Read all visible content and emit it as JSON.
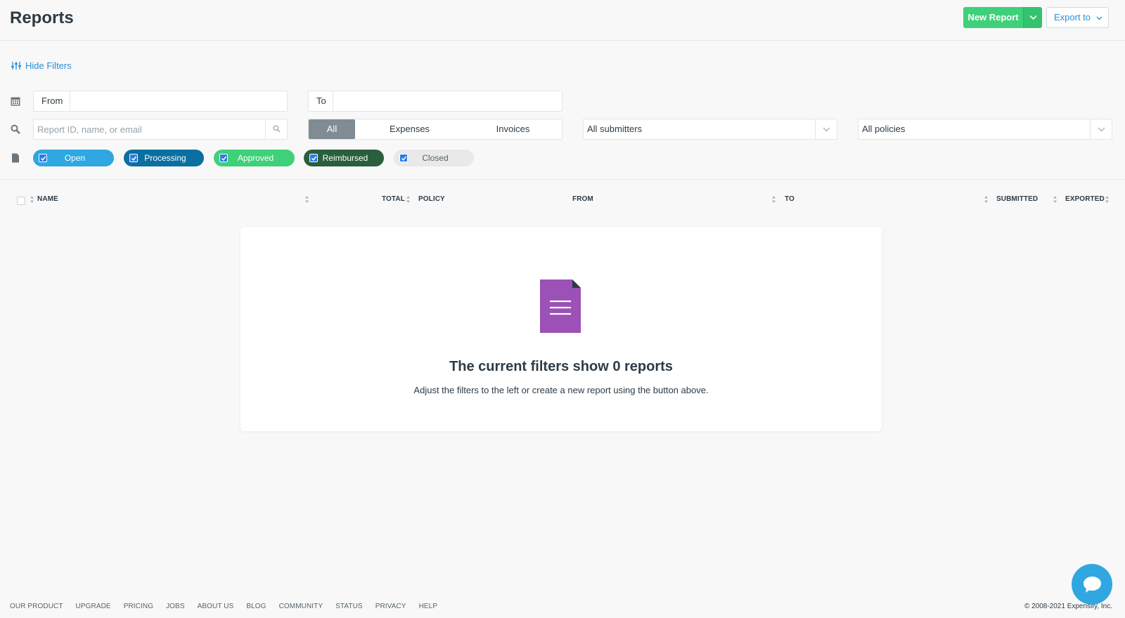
{
  "header": {
    "title": "Reports",
    "new_report_label": "New Report",
    "export_label": "Export to"
  },
  "filters": {
    "hide_filters_label": "Hide Filters",
    "from_label": "From",
    "from_value": "",
    "to_label": "To",
    "to_value": "",
    "search_placeholder": "Report ID, name, or email",
    "type_tabs": [
      {
        "label": "All",
        "active": true
      },
      {
        "label": "Expenses",
        "active": false
      },
      {
        "label": "Invoices",
        "active": false
      }
    ],
    "submitters_value": "All submitters",
    "policies_value": "All policies",
    "statuses": [
      {
        "label": "Open",
        "color": "#2fa7e0",
        "text_color": "#ffffff",
        "checked": true
      },
      {
        "label": "Processing",
        "color": "#0b6fa0",
        "text_color": "#ffffff",
        "checked": true
      },
      {
        "label": "Approved",
        "color": "#3fd07a",
        "text_color": "#ffffff",
        "checked": true
      },
      {
        "label": "Reimbursed",
        "color": "#2a5e3c",
        "text_color": "#ffffff",
        "checked": true
      },
      {
        "label": "Closed",
        "color": "#e9e9e9",
        "text_color": "#56636b",
        "checked": true
      }
    ]
  },
  "table": {
    "columns": [
      "NAME",
      "TOTAL",
      "POLICY",
      "FROM",
      "TO",
      "SUBMITTED",
      "EXPORTED"
    ]
  },
  "empty_state": {
    "title": "The current filters show 0 reports",
    "subtitle": "Adjust the filters to the left or create a new report using the button above."
  },
  "footer": {
    "links": [
      "OUR PRODUCT",
      "UPGRADE",
      "PRICING",
      "JOBS",
      "ABOUT US",
      "BLOG",
      "COMMUNITY",
      "STATUS",
      "PRIVACY",
      "HELP"
    ],
    "copyright": "© 2008-2021 Expensify, Inc."
  },
  "colors": {
    "accent_green": "#3fd07a",
    "link_blue": "#2b8fd6",
    "doc_purple": "#9b51b5"
  }
}
